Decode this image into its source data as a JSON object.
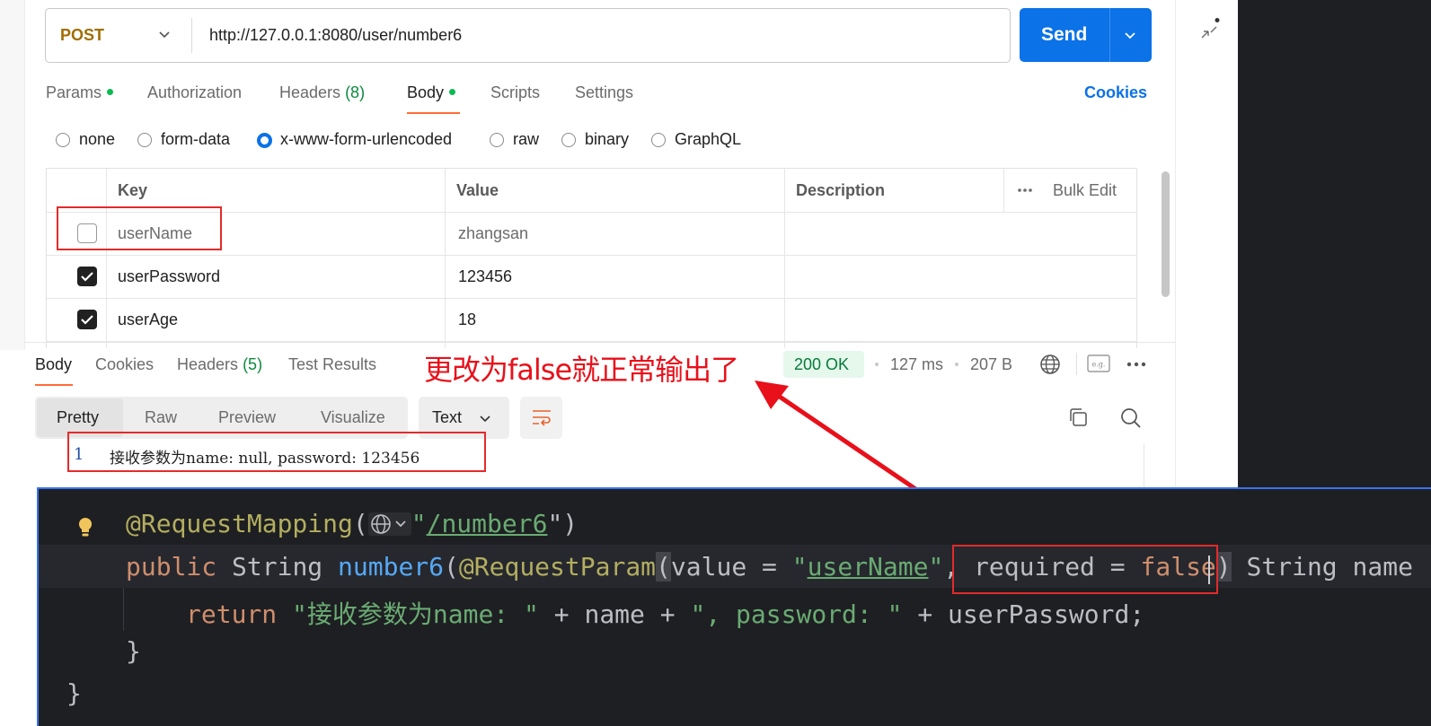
{
  "request": {
    "method": "POST",
    "url": "http://127.0.0.1:8080/user/number6",
    "send_label": "Send",
    "tabs": [
      {
        "label": "Params",
        "count": "",
        "dot": true
      },
      {
        "label": "Authorization",
        "count": "",
        "dot": false
      },
      {
        "label": "Headers",
        "count": "(8)",
        "dot": false
      },
      {
        "label": "Body",
        "count": "",
        "dot": true,
        "active": true
      },
      {
        "label": "Scripts",
        "count": "",
        "dot": false
      },
      {
        "label": "Settings",
        "count": "",
        "dot": false
      }
    ],
    "cookies_label": "Cookies",
    "body_types": [
      {
        "label": "none",
        "selected": false
      },
      {
        "label": "form-data",
        "selected": false
      },
      {
        "label": "x-www-form-urlencoded",
        "selected": true
      },
      {
        "label": "raw",
        "selected": false
      },
      {
        "label": "binary",
        "selected": false
      },
      {
        "label": "GraphQL",
        "selected": false
      }
    ],
    "table": {
      "headers": {
        "key": "Key",
        "value": "Value",
        "description": "Description",
        "bulk_edit": "Bulk Edit"
      },
      "rows": [
        {
          "checked": false,
          "key": "userName",
          "value": "zhangsan",
          "description": ""
        },
        {
          "checked": true,
          "key": "userPassword",
          "value": "123456",
          "description": ""
        },
        {
          "checked": true,
          "key": "userAge",
          "value": "18",
          "description": ""
        }
      ]
    }
  },
  "response": {
    "tabs": [
      {
        "label": "Body",
        "count": "",
        "active": true
      },
      {
        "label": "Cookies",
        "count": ""
      },
      {
        "label": "Headers",
        "count": "(5)"
      },
      {
        "label": "Test Results",
        "count": ""
      }
    ],
    "status": "200 OK",
    "time": "127 ms",
    "size": "207 B",
    "view_modes": [
      "Pretty",
      "Raw",
      "Preview",
      "Visualize"
    ],
    "active_view": "Pretty",
    "format": "Text",
    "lines": [
      {
        "num": "1",
        "text": "接收参数为name: null, password: 123456"
      }
    ]
  },
  "annotation": "更改为false就正常输出了",
  "code": {
    "line1": {
      "ann": "@RequestMapping",
      "p1": "(",
      "p2": "\"",
      "str": "/number6",
      "p3": "\")"
    },
    "line2": {
      "kw": "public",
      "type": " String ",
      "fn": "number6",
      "p1": "(",
      "ann": "@RequestParam",
      "p2": "(",
      "t1": "value = ",
      "q1": "\"",
      "str": "userName",
      "q2": "\"",
      "t2": ", required = ",
      "kw2": "false",
      "p3": ")",
      "t3": " String name"
    },
    "line3": {
      "kw": "return",
      "str1": "\"接收参数为name: \"",
      "t1": " + name + ",
      "str2": "\", password: \"",
      "t2": " + userPassword;"
    },
    "line4": "}",
    "line5": "}"
  },
  "colors": {
    "accent": "#0b72e7",
    "tab_underline": "#ff6c37",
    "annotation": "#e8101a",
    "code_bg": "#1e1f22"
  }
}
